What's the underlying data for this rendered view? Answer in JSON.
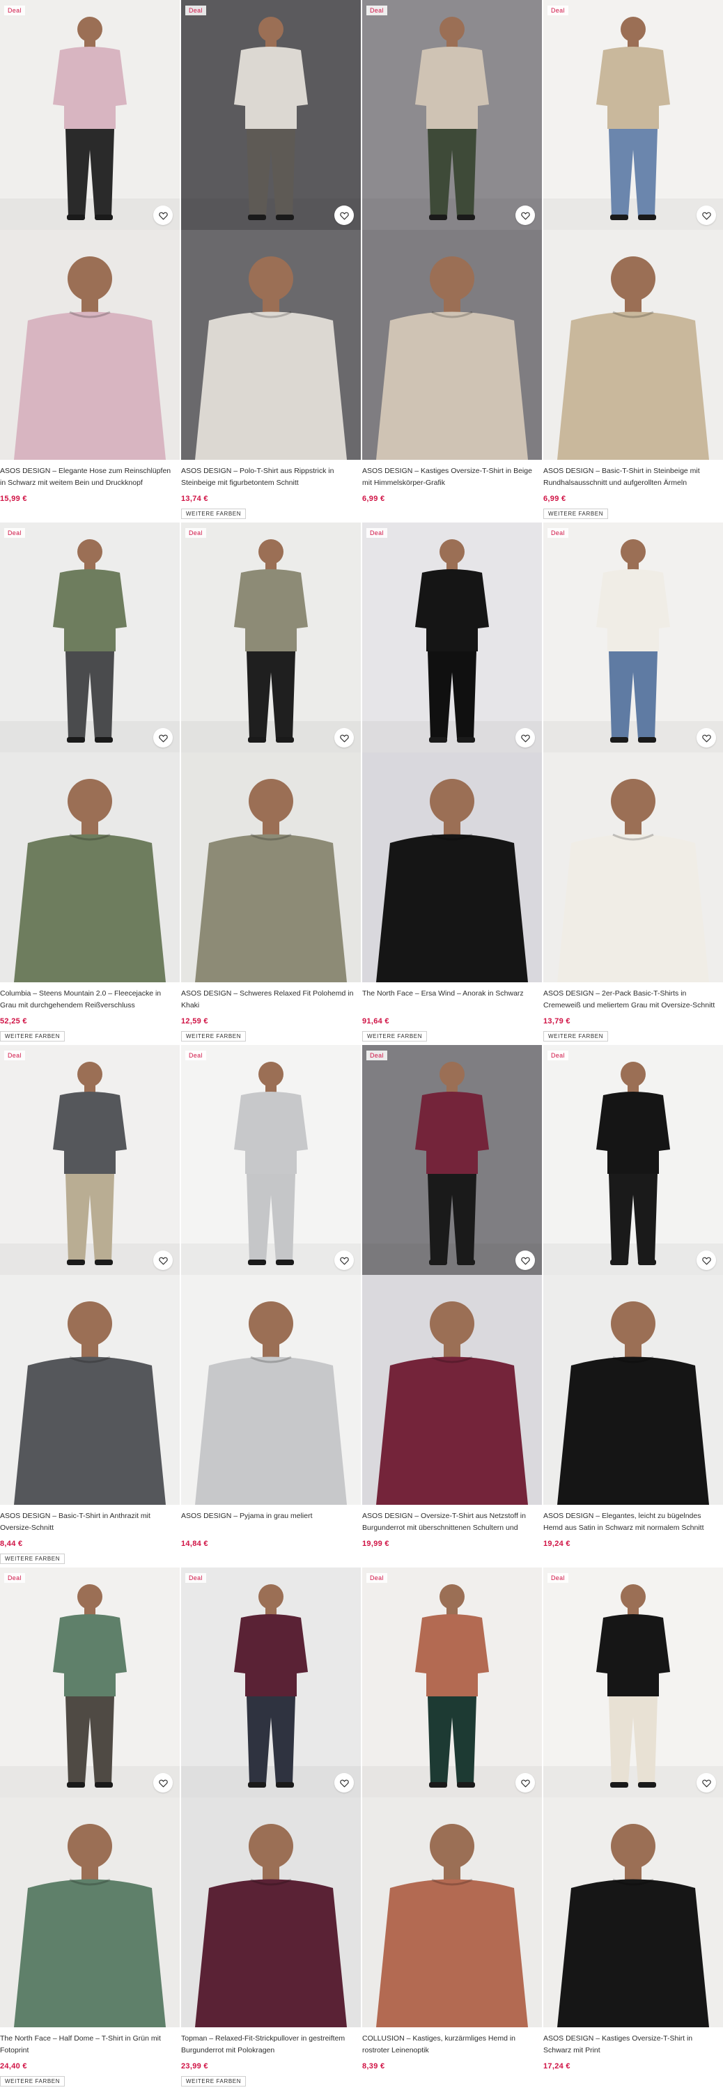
{
  "products": [
    {
      "deal": "Deal",
      "title": "ASOS DESIGN – Elegante Hose zum Reinschlüpfen in Schwarz mit weitem Bein und Druckknopf",
      "price": "15,99 €",
      "more_colors": "",
      "bg": [
        "#f0efed",
        "#ebe9e7"
      ],
      "look": [
        "#d8b5c1",
        "#2a2a2a"
      ]
    },
    {
      "deal": "Deal",
      "title": "ASOS DESIGN – Polo-T-Shirt aus Rippstrick in Steinbeige mit figurbetontem Schnitt",
      "price": "13,74 €",
      "more_colors": "WEITERE FARBEN",
      "bg": [
        "#5b5a5d",
        "#6a696c"
      ],
      "look": [
        "#dcd8d2",
        "#5e5a55"
      ]
    },
    {
      "deal": "Deal",
      "title": "ASOS DESIGN – Kastiges Oversize-T-Shirt in Beige mit Himmelskörper-Grafik",
      "price": "6,99 €",
      "more_colors": "",
      "bg": [
        "#8d8b8f",
        "#7f7d81"
      ],
      "look": [
        "#cfc3b4",
        "#3e4a38"
      ]
    },
    {
      "deal": "Deal",
      "title": "ASOS DESIGN – Basic-T-Shirt in Steinbeige mit Rundhalsausschnitt und aufgerollten Ärmeln",
      "price": "6,99 €",
      "more_colors": "WEITERE FARBEN",
      "bg": [
        "#f3f2f0",
        "#efeeec"
      ],
      "look": [
        "#c9b89c",
        "#6b86ad"
      ]
    },
    {
      "deal": "Deal",
      "title": "Columbia – Steens Mountain 2.0 – Fleecejacke in Grau mit durchgehendem Reißverschluss",
      "price": "52,25 €",
      "more_colors": "WEITERE FARBEN",
      "bg": [
        "#ededec",
        "#e9e9e8"
      ],
      "look": [
        "#6e7d5e",
        "#4a4b4d"
      ]
    },
    {
      "deal": "Deal",
      "title": "ASOS DESIGN – Schweres Relaxed Fit Polohemd in Khaki",
      "price": "12,59 €",
      "more_colors": "WEITERE FARBEN",
      "bg": [
        "#ececea",
        "#e6e6e3"
      ],
      "look": [
        "#8d8b76",
        "#1f1f1f"
      ]
    },
    {
      "deal": "Deal",
      "title": "The North Face – Ersa Wind – Anorak in Schwarz",
      "price": "91,64 €",
      "more_colors": "WEITERE FARBEN",
      "bg": [
        "#e6e5e8",
        "#d9d8dd"
      ],
      "look": [
        "#151515",
        "#101010"
      ]
    },
    {
      "deal": "Deal",
      "title": "ASOS DESIGN – 2er-Pack Basic-T-Shirts in Cremeweiß und meliertem Grau mit Oversize-Schnitt",
      "price": "13,79 €",
      "more_colors": "WEITERE FARBEN",
      "bg": [
        "#f2f1ef",
        "#efeeec"
      ],
      "look": [
        "#f0ede6",
        "#5f7ba3"
      ]
    },
    {
      "deal": "Deal",
      "title": "ASOS DESIGN – Basic-T-Shirt in Anthrazit mit Oversize-Schnitt",
      "price": "8,44 €",
      "more_colors": "WEITERE FARBEN",
      "bg": [
        "#f1f0ef",
        "#efefee"
      ],
      "look": [
        "#55575b",
        "#b9ad93"
      ]
    },
    {
      "deal": "Deal",
      "title": "ASOS DESIGN – Pyjama in grau meliert",
      "price": "14,84 €",
      "more_colors": "",
      "bg": [
        "#f4f4f3",
        "#f2f2f1"
      ],
      "look": [
        "#c7c8ca",
        "#c5c6c8"
      ]
    },
    {
      "deal": "Deal",
      "title": "ASOS DESIGN – Oversize-T-Shirt aus Netzstoff in Burgunderrot mit überschnittenen Schultern und großer Zahlengrafik",
      "price": "19,99 €",
      "more_colors": "",
      "bg": [
        "#7f7e82",
        "#dad9dd"
      ],
      "look": [
        "#74243a",
        "#1a1a1a"
      ]
    },
    {
      "deal": "Deal",
      "title": "ASOS DESIGN – Elegantes, leicht zu bügelndes Hemd aus Satin in Schwarz mit normalem Schnitt",
      "price": "19,24 €",
      "more_colors": "",
      "bg": [
        "#f3f3f2",
        "#ededec"
      ],
      "look": [
        "#151515",
        "#1a1a1a"
      ]
    },
    {
      "deal": "Deal",
      "title": "The North Face – Half Dome – T-Shirt in Grün mit Fotoprint",
      "price": "24,40 €",
      "more_colors": "WEITERE FARBEN",
      "bg": [
        "#f2f1ef",
        "#ecebe9"
      ],
      "look": [
        "#5f806a",
        "#4f4a44"
      ]
    },
    {
      "deal": "Deal",
      "title": "Topman – Relaxed-Fit-Strickpullover in gestreiftem Burgunderrot mit Polokragen",
      "price": "23,99 €",
      "more_colors": "WEITERE FARBEN",
      "bg": [
        "#e9e9e9",
        "#e3e3e3"
      ],
      "look": [
        "#5a2235",
        "#2f3340"
      ]
    },
    {
      "deal": "Deal",
      "title": "COLLUSION – Kastiges, kurzärmliges Hemd in rostroter Leinenoptik",
      "price": "8,39 €",
      "more_colors": "",
      "bg": [
        "#f1efed",
        "#ecebe9"
      ],
      "look": [
        "#b36a52",
        "#1d3a33"
      ]
    },
    {
      "deal": "Deal",
      "title": "ASOS DESIGN – Kastiges Oversize-T-Shirt in Schwarz mit Print",
      "price": "17,24 €",
      "more_colors": "",
      "bg": [
        "#f4f3f1",
        "#efeeec"
      ],
      "look": [
        "#161616",
        "#e8e1d4"
      ]
    }
  ]
}
